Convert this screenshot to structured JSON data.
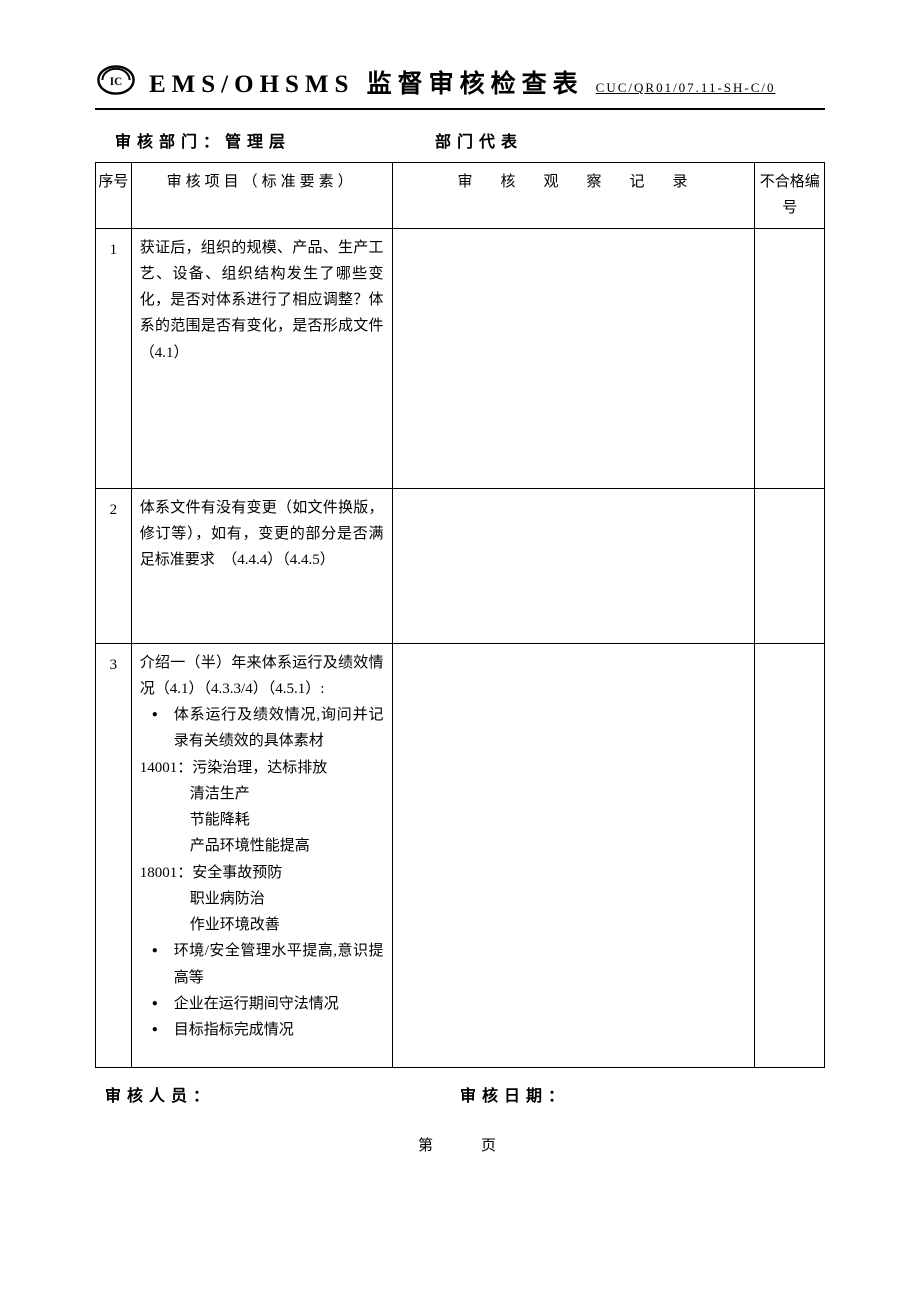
{
  "header": {
    "title": "EMS/OHSMS 监督审核检查表",
    "code": "CUC/QR01/07.11-SH-C/0"
  },
  "meta": {
    "dept_label": "审核部门：",
    "dept_value": "管理层",
    "rep_label": "部门代表"
  },
  "columns": {
    "num": "序号",
    "item": "审核项目（标准要素）",
    "record": "审核观察记录",
    "nc": "不合格编号"
  },
  "rows": [
    {
      "num": "1",
      "lines": [
        "获证后，组织的规模、产品、生产工艺、设备、组织结构发生了哪些变化，是否对体系进行了相应调整？体系的范围是否有变化，是否形成文件（4.1）"
      ]
    },
    {
      "num": "2",
      "lines": [
        "体系文件有没有变更（如文件换版，修订等），如有，变更的部分是否满足标准要求　（4.4.4）（4.4.5）"
      ]
    },
    {
      "num": "3",
      "intro": "介绍一（半）年来体系运行及绩效情况（4.1）（4.3.3/4）（4.5.1）:",
      "bullets_top": [
        "体系运行及绩效情况,询问并记录有关绩效的具体素材"
      ],
      "s14001_label": "14001：",
      "s14001": [
        "污染治理，达标排放",
        "清洁生产",
        "节能降耗",
        "产品环境性能提高"
      ],
      "s18001_label": "18001：",
      "s18001": [
        "安全事故预防",
        "职业病防治",
        "作业环境改善"
      ],
      "bullets_bottom": [
        "环境/安全管理水平提高,意识提高等",
        "企业在运行期间守法情况",
        "目标指标完成情况"
      ]
    }
  ],
  "footer": {
    "auditor": "审核人员：",
    "date": "审核日期：",
    "page": "第　　页"
  }
}
